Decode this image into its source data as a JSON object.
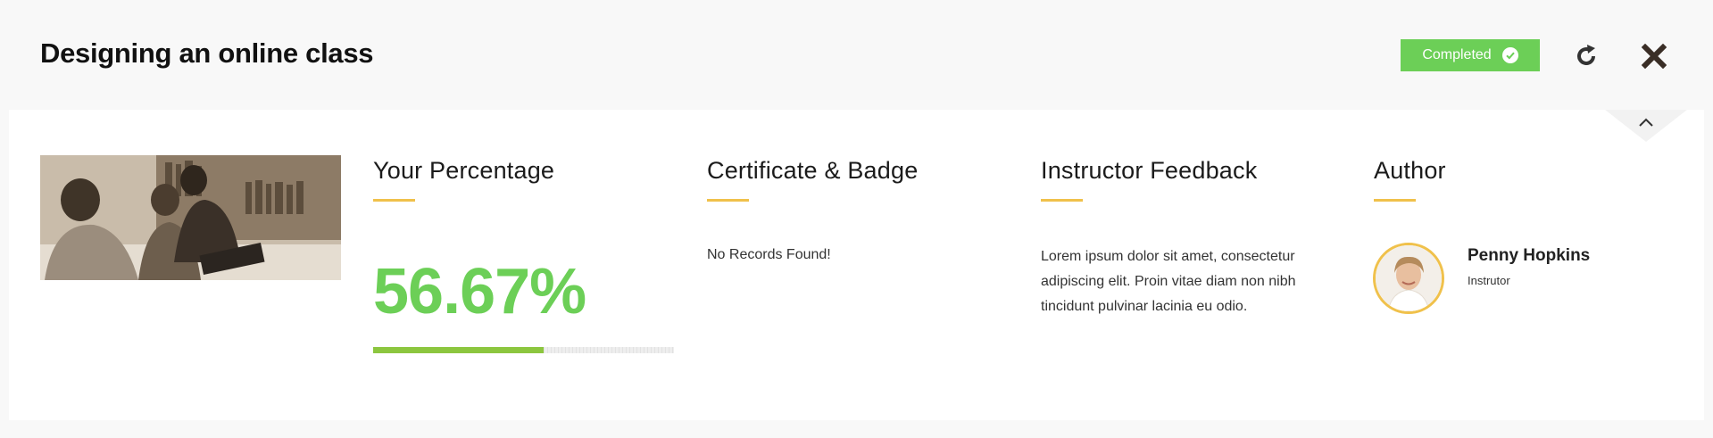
{
  "header": {
    "title": "Designing an online class",
    "status": "Completed",
    "status_color": "#6ccf57",
    "icons": [
      "check-circle-icon",
      "reload-icon",
      "close-icon",
      "chevron-up-icon"
    ]
  },
  "percentage": {
    "heading": "Your Percentage",
    "value": "56.67%",
    "progress": 0.5667,
    "progress_color": "#8cc63f"
  },
  "certificate": {
    "heading": "Certificate & Badge",
    "empty_text": "No Records Found!"
  },
  "feedback": {
    "heading": "Instructor Feedback",
    "text": "Lorem ipsum dolor sit amet, consectetur adipiscing elit. Proin vitae diam non nibh tincidunt pulvinar lacinia eu odio."
  },
  "author": {
    "heading": "Author",
    "name": "Penny Hopkins",
    "role": "Instrutor"
  },
  "accent_color": "#f0c14b"
}
